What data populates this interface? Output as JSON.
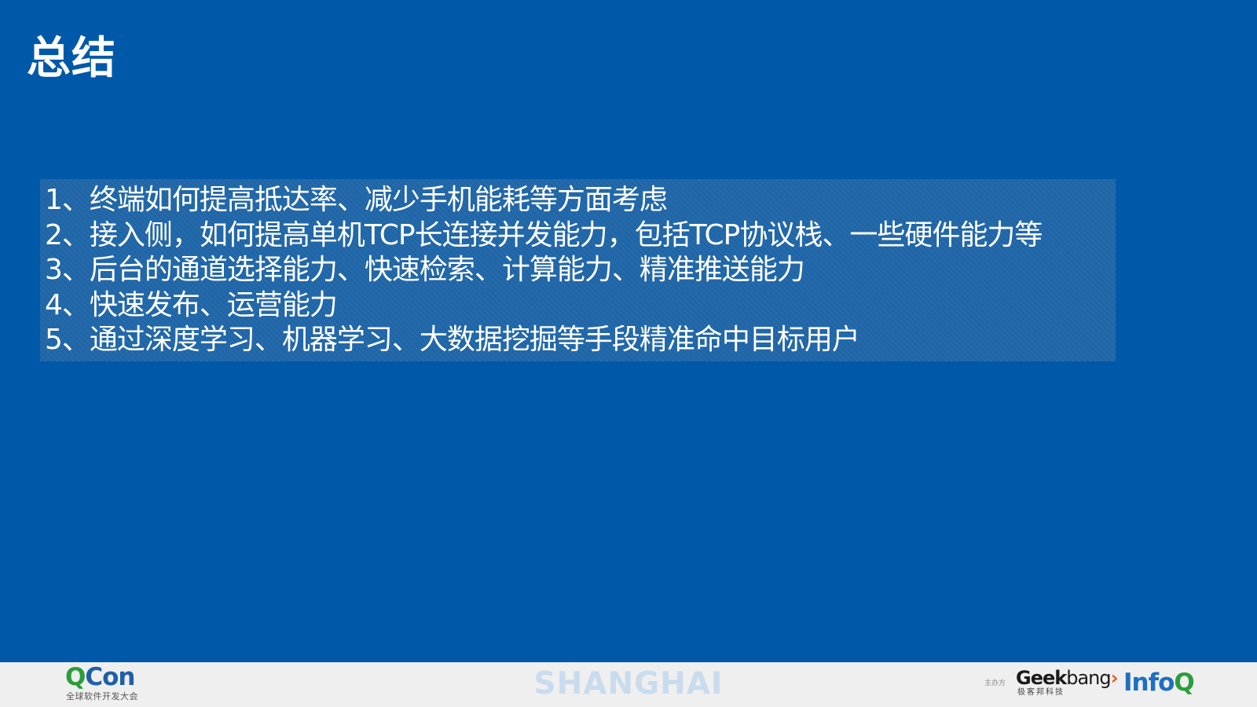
{
  "slide": {
    "title": "总结",
    "items": [
      "1、终端如何提高抵达率、减少手机能耗等方面考虑",
      "2、接入侧，如何提高单机TCP长连接并发能力，包括TCP协议栈、一些硬件能力等",
      "3、后台的通道选择能力、快速检索、计算能力、精准推送能力",
      "4、快速发布、运营能力",
      "5、通过深度学习、机器学习、大数据挖掘等手段精准命中目标用户"
    ],
    "background_color": "#0059a8"
  },
  "footer": {
    "qcon": {
      "q": "Q",
      "con": "Con",
      "subtitle": "全球软件开发大会"
    },
    "city": "SHANGHAI",
    "sponsor_label": "主办方",
    "geekbang": {
      "geek": "Gee",
      "k": "k",
      "bang": "bang",
      "arrow": "›",
      "subtitle": "极客邦科技"
    },
    "infoq": {
      "info": "Info",
      "q": "Q"
    },
    "background_color": "#efefef"
  }
}
